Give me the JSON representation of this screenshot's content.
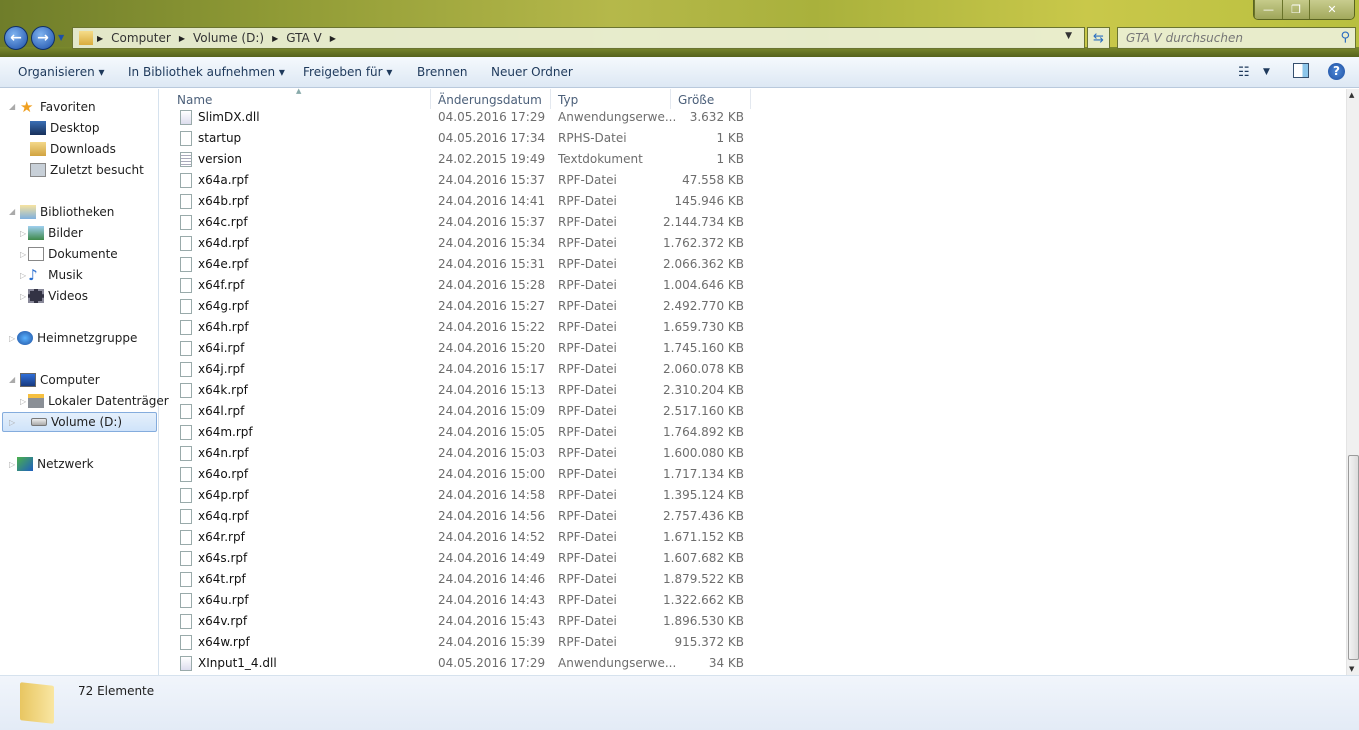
{
  "window": {
    "minimize": "—",
    "maximize": "❐",
    "close": "✕"
  },
  "address": {
    "crumbs": [
      "Computer",
      "Volume (D:)",
      "GTA V"
    ],
    "search_placeholder": "GTA V durchsuchen"
  },
  "toolbar": {
    "organize": "Organisieren ▾",
    "library": "In Bibliothek aufnehmen ▾",
    "share": "Freigeben für ▾",
    "burn": "Brennen",
    "new_folder": "Neuer Ordner"
  },
  "sidebar": {
    "favorites": "Favoriten",
    "desktop": "Desktop",
    "downloads": "Downloads",
    "recent": "Zuletzt besucht",
    "libraries": "Bibliotheken",
    "pictures": "Bilder",
    "documents": "Dokumente",
    "music": "Musik",
    "videos": "Videos",
    "homegroup": "Heimnetzgruppe",
    "computer": "Computer",
    "local_disk": "Lokaler Datenträger",
    "volume_d": "Volume (D:)",
    "network": "Netzwerk"
  },
  "columns": {
    "name": "Name",
    "date": "Änderungsdatum",
    "type": "Typ",
    "size": "Größe"
  },
  "files": [
    {
      "name": "SlimDX.dll",
      "date": "04.05.2016 17:29",
      "type": "Anwendungserwe...",
      "size": "3.632 KB",
      "icon": "dll"
    },
    {
      "name": "startup",
      "date": "04.05.2016 17:34",
      "type": "RPHS-Datei",
      "size": "1 KB",
      "icon": "file"
    },
    {
      "name": "version",
      "date": "24.02.2015 19:49",
      "type": "Textdokument",
      "size": "1 KB",
      "icon": "text"
    },
    {
      "name": "x64a.rpf",
      "date": "24.04.2016 15:37",
      "type": "RPF-Datei",
      "size": "47.558 KB",
      "icon": "file"
    },
    {
      "name": "x64b.rpf",
      "date": "24.04.2016 14:41",
      "type": "RPF-Datei",
      "size": "145.946 KB",
      "icon": "file"
    },
    {
      "name": "x64c.rpf",
      "date": "24.04.2016 15:37",
      "type": "RPF-Datei",
      "size": "2.144.734 KB",
      "icon": "file"
    },
    {
      "name": "x64d.rpf",
      "date": "24.04.2016 15:34",
      "type": "RPF-Datei",
      "size": "1.762.372 KB",
      "icon": "file"
    },
    {
      "name": "x64e.rpf",
      "date": "24.04.2016 15:31",
      "type": "RPF-Datei",
      "size": "2.066.362 KB",
      "icon": "file"
    },
    {
      "name": "x64f.rpf",
      "date": "24.04.2016 15:28",
      "type": "RPF-Datei",
      "size": "1.004.646 KB",
      "icon": "file"
    },
    {
      "name": "x64g.rpf",
      "date": "24.04.2016 15:27",
      "type": "RPF-Datei",
      "size": "2.492.770 KB",
      "icon": "file"
    },
    {
      "name": "x64h.rpf",
      "date": "24.04.2016 15:22",
      "type": "RPF-Datei",
      "size": "1.659.730 KB",
      "icon": "file"
    },
    {
      "name": "x64i.rpf",
      "date": "24.04.2016 15:20",
      "type": "RPF-Datei",
      "size": "1.745.160 KB",
      "icon": "file"
    },
    {
      "name": "x64j.rpf",
      "date": "24.04.2016 15:17",
      "type": "RPF-Datei",
      "size": "2.060.078 KB",
      "icon": "file"
    },
    {
      "name": "x64k.rpf",
      "date": "24.04.2016 15:13",
      "type": "RPF-Datei",
      "size": "2.310.204 KB",
      "icon": "file"
    },
    {
      "name": "x64l.rpf",
      "date": "24.04.2016 15:09",
      "type": "RPF-Datei",
      "size": "2.517.160 KB",
      "icon": "file"
    },
    {
      "name": "x64m.rpf",
      "date": "24.04.2016 15:05",
      "type": "RPF-Datei",
      "size": "1.764.892 KB",
      "icon": "file"
    },
    {
      "name": "x64n.rpf",
      "date": "24.04.2016 15:03",
      "type": "RPF-Datei",
      "size": "1.600.080 KB",
      "icon": "file"
    },
    {
      "name": "x64o.rpf",
      "date": "24.04.2016 15:00",
      "type": "RPF-Datei",
      "size": "1.717.134 KB",
      "icon": "file"
    },
    {
      "name": "x64p.rpf",
      "date": "24.04.2016 14:58",
      "type": "RPF-Datei",
      "size": "1.395.124 KB",
      "icon": "file"
    },
    {
      "name": "x64q.rpf",
      "date": "24.04.2016 14:56",
      "type": "RPF-Datei",
      "size": "2.757.436 KB",
      "icon": "file"
    },
    {
      "name": "x64r.rpf",
      "date": "24.04.2016 14:52",
      "type": "RPF-Datei",
      "size": "1.671.152 KB",
      "icon": "file"
    },
    {
      "name": "x64s.rpf",
      "date": "24.04.2016 14:49",
      "type": "RPF-Datei",
      "size": "1.607.682 KB",
      "icon": "file"
    },
    {
      "name": "x64t.rpf",
      "date": "24.04.2016 14:46",
      "type": "RPF-Datei",
      "size": "1.879.522 KB",
      "icon": "file"
    },
    {
      "name": "x64u.rpf",
      "date": "24.04.2016 14:43",
      "type": "RPF-Datei",
      "size": "1.322.662 KB",
      "icon": "file"
    },
    {
      "name": "x64v.rpf",
      "date": "24.04.2016 15:43",
      "type": "RPF-Datei",
      "size": "1.896.530 KB",
      "icon": "file"
    },
    {
      "name": "x64w.rpf",
      "date": "24.04.2016 15:39",
      "type": "RPF-Datei",
      "size": "915.372 KB",
      "icon": "file"
    },
    {
      "name": "XInput1_4.dll",
      "date": "04.05.2016 17:29",
      "type": "Anwendungserwe...",
      "size": "34 KB",
      "icon": "dll"
    }
  ],
  "status": {
    "count": "72 Elemente"
  },
  "scroll": {
    "position_fraction": 0.85
  }
}
